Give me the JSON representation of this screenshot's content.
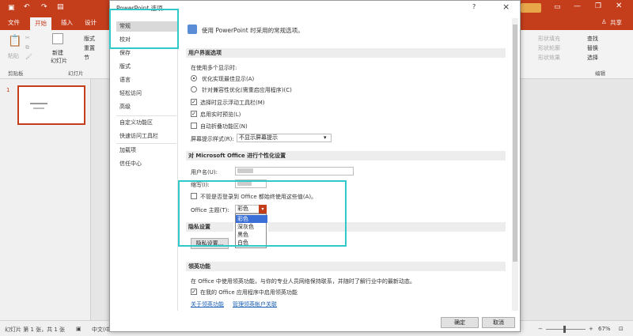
{
  "app": {
    "ribbon_tabs": [
      "文件",
      "开始",
      "插入",
      "设计"
    ],
    "share": "共享",
    "clipboard": {
      "paste": "粘贴",
      "group": "剪贴板"
    },
    "slides": {
      "new_slide": "新建",
      "new_slide2": "幻灯片",
      "layout": "版式",
      "reset": "重置",
      "section": "节",
      "group": "幻灯片"
    },
    "drawing": {
      "fill": "形状填充",
      "outline": "形状轮廓",
      "effect": "形状效果"
    },
    "editing": {
      "find": "查找",
      "replace": "替换",
      "select": "选择",
      "group": "编辑"
    },
    "slide_number": "1",
    "status": {
      "slide_info": "幻灯片 第 1 张，共 1 张",
      "language": "中文(中国)",
      "zoom": "67%"
    }
  },
  "dialog": {
    "title": "PowerPoint 选项",
    "help": "?",
    "close": "×",
    "nav": [
      "常规",
      "校对",
      "保存",
      "版式",
      "语言",
      "轻松访问",
      "高级",
      "自定义功能区",
      "快速访问工具栏",
      "加载项",
      "信任中心"
    ],
    "header": "使用 PowerPoint 时采用的常规选项。",
    "ui_section": "用户界面选项",
    "multi_display": "在使用多个显示时:",
    "opt_appearance": "优化实现最佳显示(A)",
    "opt_compat": "针对兼容性优化(需重启应用程序)(C)",
    "cb_minitoolbar": "选择时显示浮动工具栏(M)",
    "cb_livepreview": "启用实时预览(L)",
    "cb_collapse": "自动折叠功能区(N)",
    "screentip_label": "屏幕提示样式(R):",
    "screentip_value": "不显示屏幕提示",
    "personalize_section": "对 Microsoft Office 进行个性化设置",
    "username_label": "用户名(U):",
    "initials_label": "缩写(I):",
    "cb_always": "不管是否登录到 Office 都始终使用这些值(A)。",
    "theme_label": "Office 主题(T):",
    "theme_value": "彩色",
    "theme_options": [
      "彩色",
      "深灰色",
      "黑色",
      "白色"
    ],
    "privacy_section": "隐私设置",
    "privacy_button": "隐私设置...",
    "linkedin_section": "领英功能",
    "linkedin_desc": "在 Office 中使用领英功能，与你的专业人员网络保持联系，并随时了解行业中的最新动态。",
    "cb_linkedin": "在我的 Office 应用程序中启用领英功能",
    "link_about": "关于领英功能",
    "link_manage": "管理领英帐户关联",
    "ok": "确定",
    "cancel": "取消"
  },
  "colors": {
    "accent": "#c43e1c",
    "highlight": "#2fc9c9",
    "selection": "#3a6fd8"
  }
}
